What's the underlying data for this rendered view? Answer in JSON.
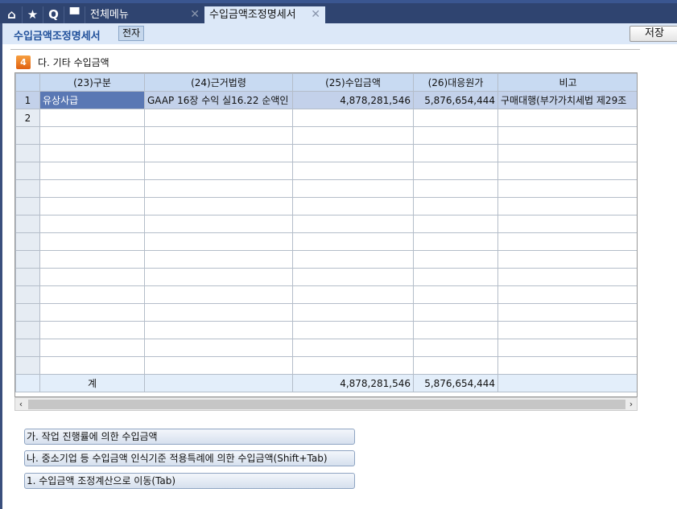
{
  "tabs": {
    "menu_label": "전체메뉴",
    "active_label": "수입금액조정명세서",
    "close": "✕"
  },
  "header": {
    "title": "수입금액조정명세서",
    "badge": "전자",
    "save": "저장"
  },
  "section": {
    "number": "4",
    "title": "다. 기타 수입금액"
  },
  "table": {
    "columns": [
      "(23)구분",
      "(24)근거법령",
      "(25)수입금액",
      "(26)대응원가",
      "비고"
    ],
    "rows": [
      {
        "no": "1",
        "category": "유상사급",
        "law": "GAAP 16장 수익 실16.22 순액인",
        "revenue": "4,878,281,546",
        "cost": "5,876,654,444",
        "note": "구매대행(부가가치세법 제29조"
      },
      {
        "no": "2",
        "category": "",
        "law": "",
        "revenue": "",
        "cost": "",
        "note": ""
      }
    ],
    "total": {
      "label": "계",
      "revenue": "4,878,281,546",
      "cost": "5,876,654,444"
    }
  },
  "buttons": [
    "가. 작업 진행률에 의한 수입금액",
    "나. 중소기업 등 수입금액 인식기준 적용특례에 의한 수입금액(Shift+Tab)",
    "1. 수입금액 조정계산으로 이동(Tab)"
  ]
}
